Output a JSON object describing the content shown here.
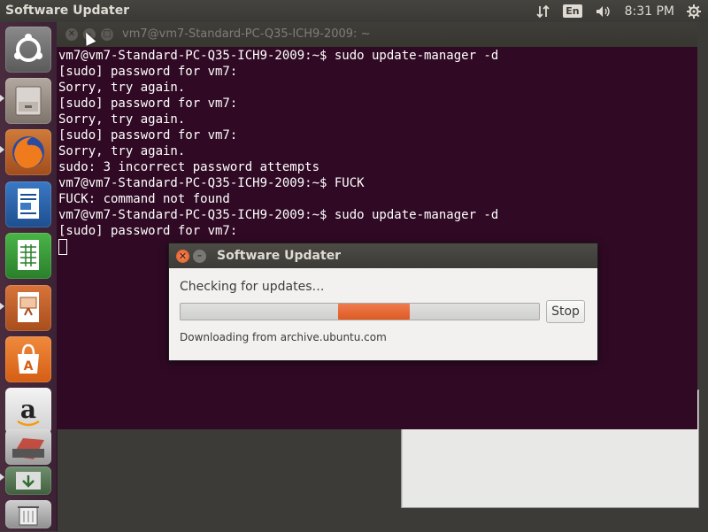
{
  "top_panel": {
    "app_title": "Software Updater",
    "language": "En",
    "time": "8:31 PM",
    "icons": [
      "network-transfer-icon",
      "keyboard-language-icon",
      "volume-icon",
      "settings-gear-icon"
    ]
  },
  "launcher": {
    "items": [
      {
        "name": "ubuntu-dash",
        "icon": "ubuntu-logo-icon"
      },
      {
        "name": "files",
        "icon": "file-cabinet-icon"
      },
      {
        "name": "firefox",
        "icon": "firefox-icon"
      },
      {
        "name": "libreoffice-writer",
        "icon": "writer-document-icon"
      },
      {
        "name": "libreoffice-calc",
        "icon": "calc-spreadsheet-icon"
      },
      {
        "name": "libreoffice-impress",
        "icon": "impress-presentation-icon"
      },
      {
        "name": "ubuntu-software",
        "icon": "software-center-icon"
      },
      {
        "name": "amazon",
        "icon": "amazon-icon"
      },
      {
        "name": "system-settings",
        "icon": "system-settings-icon"
      },
      {
        "name": "software-updater",
        "icon": "software-updater-icon"
      },
      {
        "name": "trash",
        "icon": "trash-icon"
      }
    ]
  },
  "terminal": {
    "title": "vm7@vm7-Standard-PC-Q35-ICH9-2009: ~",
    "lines": [
      "vm7@vm7-Standard-PC-Q35-ICH9-2009:~$ sudo update-manager -d",
      "[sudo] password for vm7:",
      "Sorry, try again.",
      "[sudo] password for vm7:",
      "Sorry, try again.",
      "[sudo] password for vm7:",
      "Sorry, try again.",
      "sudo: 3 incorrect password attempts",
      "vm7@vm7-Standard-PC-Q35-ICH9-2009:~$ FUCK",
      "FUCK: command not found",
      "vm7@vm7-Standard-PC-Q35-ICH9-2009:~$ sudo update-manager -d",
      "[sudo] password for vm7:"
    ]
  },
  "dialog": {
    "title": "Software Updater",
    "status": "Checking for updates…",
    "progress_fraction": 0.2,
    "stop_label": "Stop",
    "download_text": "Downloading from archive.ubuntu.com"
  },
  "colors": {
    "terminal_bg": "#300a24",
    "accent_orange": "#e2571e",
    "panel_bg": "#3c3b37"
  }
}
